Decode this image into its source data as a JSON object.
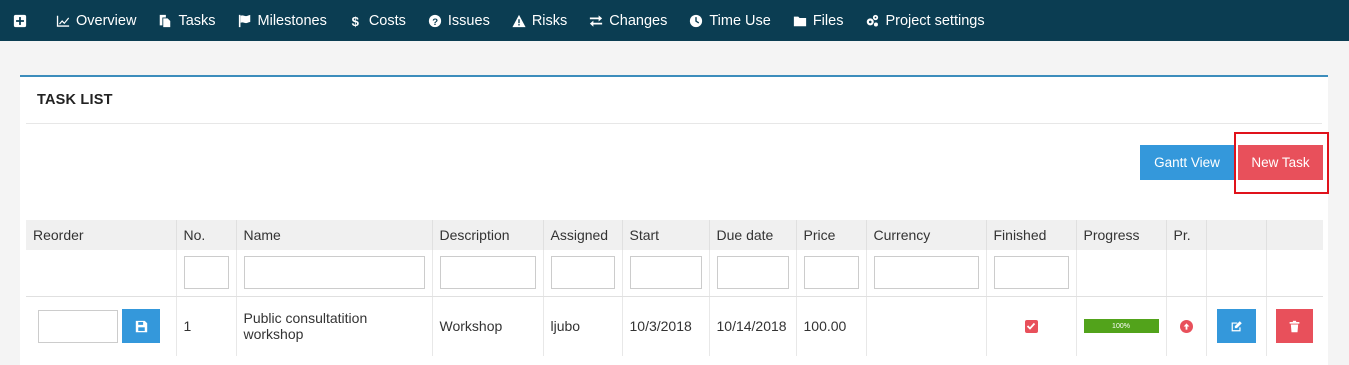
{
  "nav": {
    "items": [
      {
        "label": "Overview",
        "icon": "chart-line-icon"
      },
      {
        "label": "Tasks",
        "icon": "copy-icon"
      },
      {
        "label": "Milestones",
        "icon": "flag-icon"
      },
      {
        "label": "Costs",
        "icon": "dollar-icon"
      },
      {
        "label": "Issues",
        "icon": "question-circle-icon"
      },
      {
        "label": "Risks",
        "icon": "warning-icon"
      },
      {
        "label": "Changes",
        "icon": "exchange-icon"
      },
      {
        "label": "Time Use",
        "icon": "clock-icon"
      },
      {
        "label": "Files",
        "icon": "folder-icon"
      },
      {
        "label": "Project settings",
        "icon": "gears-icon"
      }
    ]
  },
  "box": {
    "title": "TASK LIST",
    "gantt_label": "Gantt View",
    "new_task_label": "New Task"
  },
  "table": {
    "headers": [
      "Reorder",
      "No.",
      "Name",
      "Description",
      "Assigned",
      "Start",
      "Due date",
      "Price",
      "Currency",
      "Finished",
      "Progress",
      "Pr.",
      "",
      ""
    ],
    "rows": [
      {
        "no": "1",
        "name": "Public consultatition workshop",
        "description": "Workshop",
        "assigned": "ljubo",
        "start": "10/3/2018",
        "due": "10/14/2018",
        "price": "100.00",
        "currency": "",
        "finished": true,
        "progress_label": "100%",
        "progress": 100,
        "priority_icon": "arrow-up-circle-icon"
      }
    ]
  },
  "colors": {
    "nav_bg": "#0b3d52",
    "primary": "#3498db",
    "danger": "#e8505b",
    "progress": "#52a31b",
    "highlight": "#e0121b"
  }
}
